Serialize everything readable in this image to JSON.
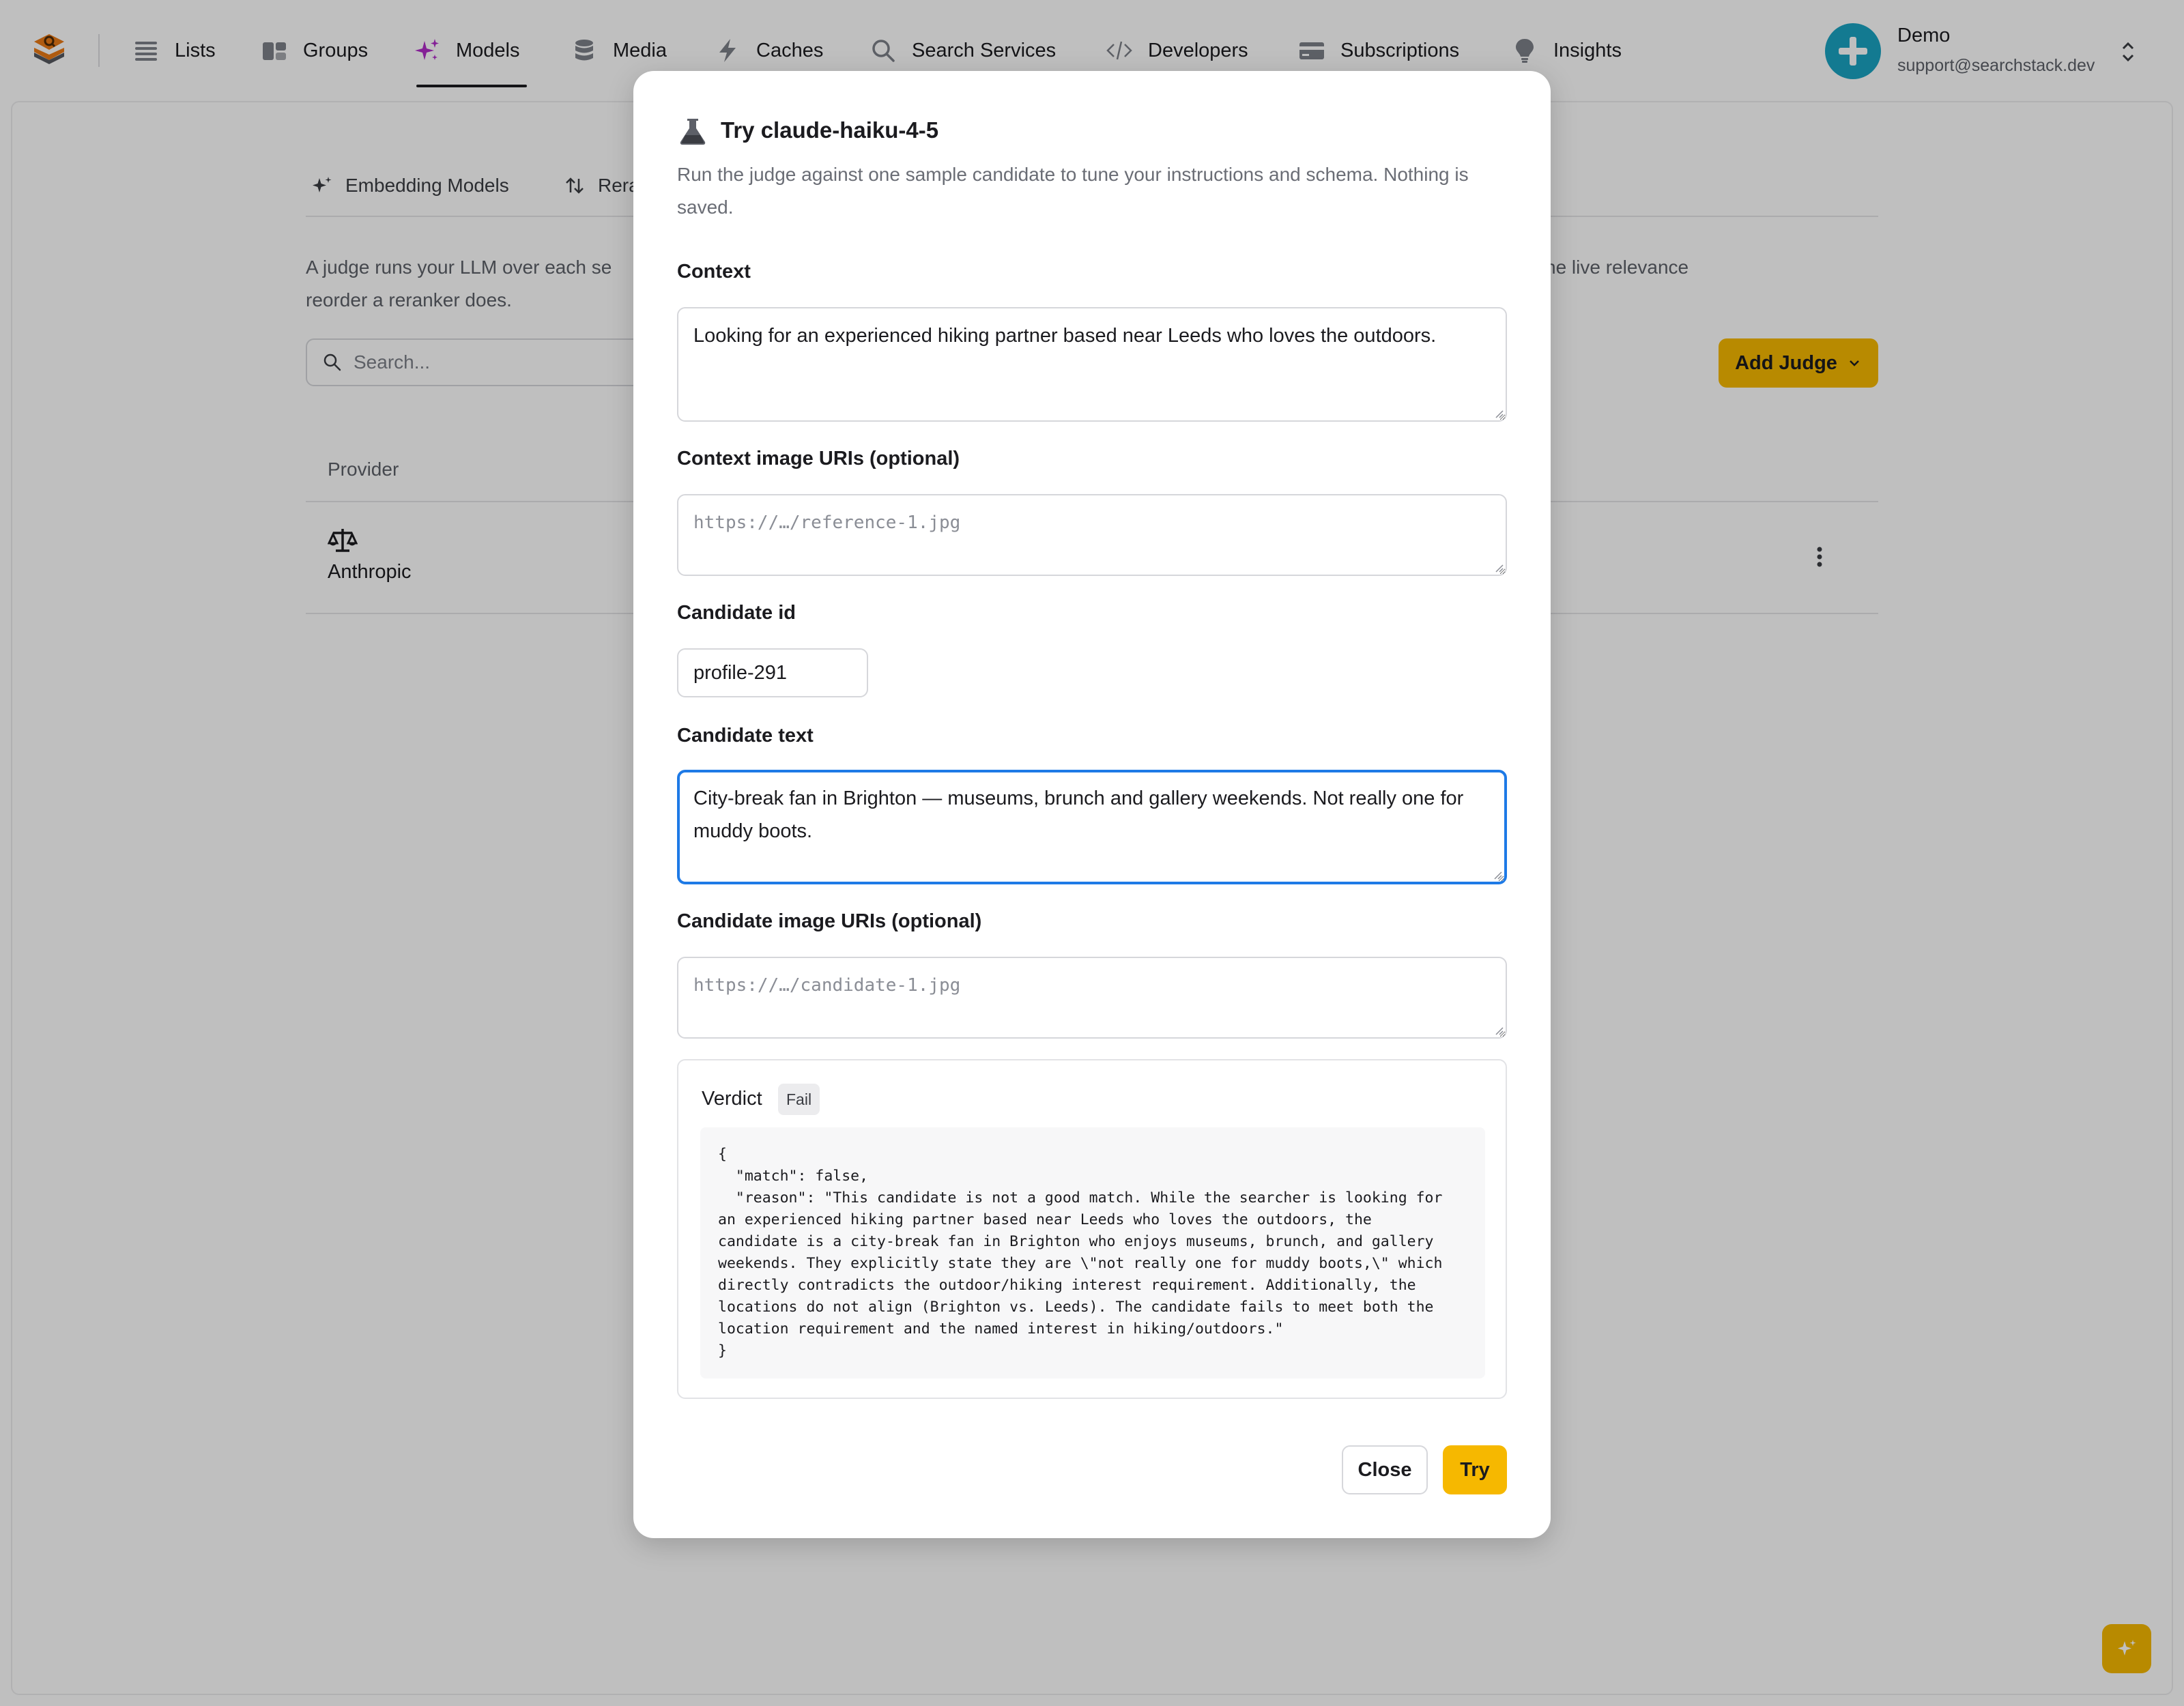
{
  "nav": {
    "items": [
      {
        "label": "Lists",
        "icon": "list-icon"
      },
      {
        "label": "Groups",
        "icon": "groups-icon"
      },
      {
        "label": "Models",
        "icon": "sparkles-icon",
        "active": true
      },
      {
        "label": "Media",
        "icon": "database-icon"
      },
      {
        "label": "Caches",
        "icon": "lightning-icon"
      },
      {
        "label": "Search Services",
        "icon": "search-icon"
      },
      {
        "label": "Developers",
        "icon": "code-icon"
      },
      {
        "label": "Subscriptions",
        "icon": "credit-card-icon"
      },
      {
        "label": "Insights",
        "icon": "lightbulb-icon"
      }
    ],
    "account": {
      "name": "Demo",
      "email": "support@searchstack.dev"
    }
  },
  "background": {
    "tabs": [
      "Embedding Models",
      "Rera"
    ],
    "intro_line1": "A judge runs your LLM over each se",
    "intro_line1_tail": "he live relevance",
    "intro_line2": "reorder a reranker does.",
    "search_placeholder": "Search...",
    "add_judge_label": "Add Judge",
    "table_header_provider": "Provider",
    "row_provider": "Anthropic"
  },
  "modal": {
    "title": "Try claude-haiku-4-5",
    "description": "Run the judge against one sample candidate to tune your instructions and schema. Nothing is saved.",
    "context_label": "Context",
    "context_value": "Looking for an experienced hiking partner based near Leeds who loves the outdoors.",
    "context_images_label": "Context image URIs (optional)",
    "context_images_placeholder": "https://…/reference-1.jpg",
    "candidate_id_label": "Candidate id",
    "candidate_id_value": "profile-291",
    "candidate_text_label": "Candidate text",
    "candidate_text_value": "City-break fan in Brighton — museums, brunch and gallery weekends. Not really one for muddy boots.",
    "candidate_images_label": "Candidate image URIs (optional)",
    "candidate_images_placeholder": "https://…/candidate-1.jpg",
    "verdict_label": "Verdict",
    "verdict_badge": "Fail",
    "verdict_json": "{\n  \"match\": false,\n  \"reason\": \"This candidate is not a good match. While the searcher is looking for\nan experienced hiking partner based near Leeds who loves the outdoors, the\ncandidate is a city-break fan in Brighton who enjoys museums, brunch, and gallery\nweekends. They explicitly state they are \\\"not really one for muddy boots,\\\" which\ndirectly contradicts the outdoor/hiking interest requirement. Additionally, the\nlocations do not align (Brighton vs. Leeds). The candidate fails to meet both the\nlocation requirement and the named interest in hiking/outdoors.\"\n}",
    "close_label": "Close",
    "try_label": "Try"
  },
  "colors": {
    "accent": "#f6b800",
    "focus": "#1e7ae6",
    "active_icon": "#b12cc9",
    "avatar": "#1aa3c2"
  }
}
